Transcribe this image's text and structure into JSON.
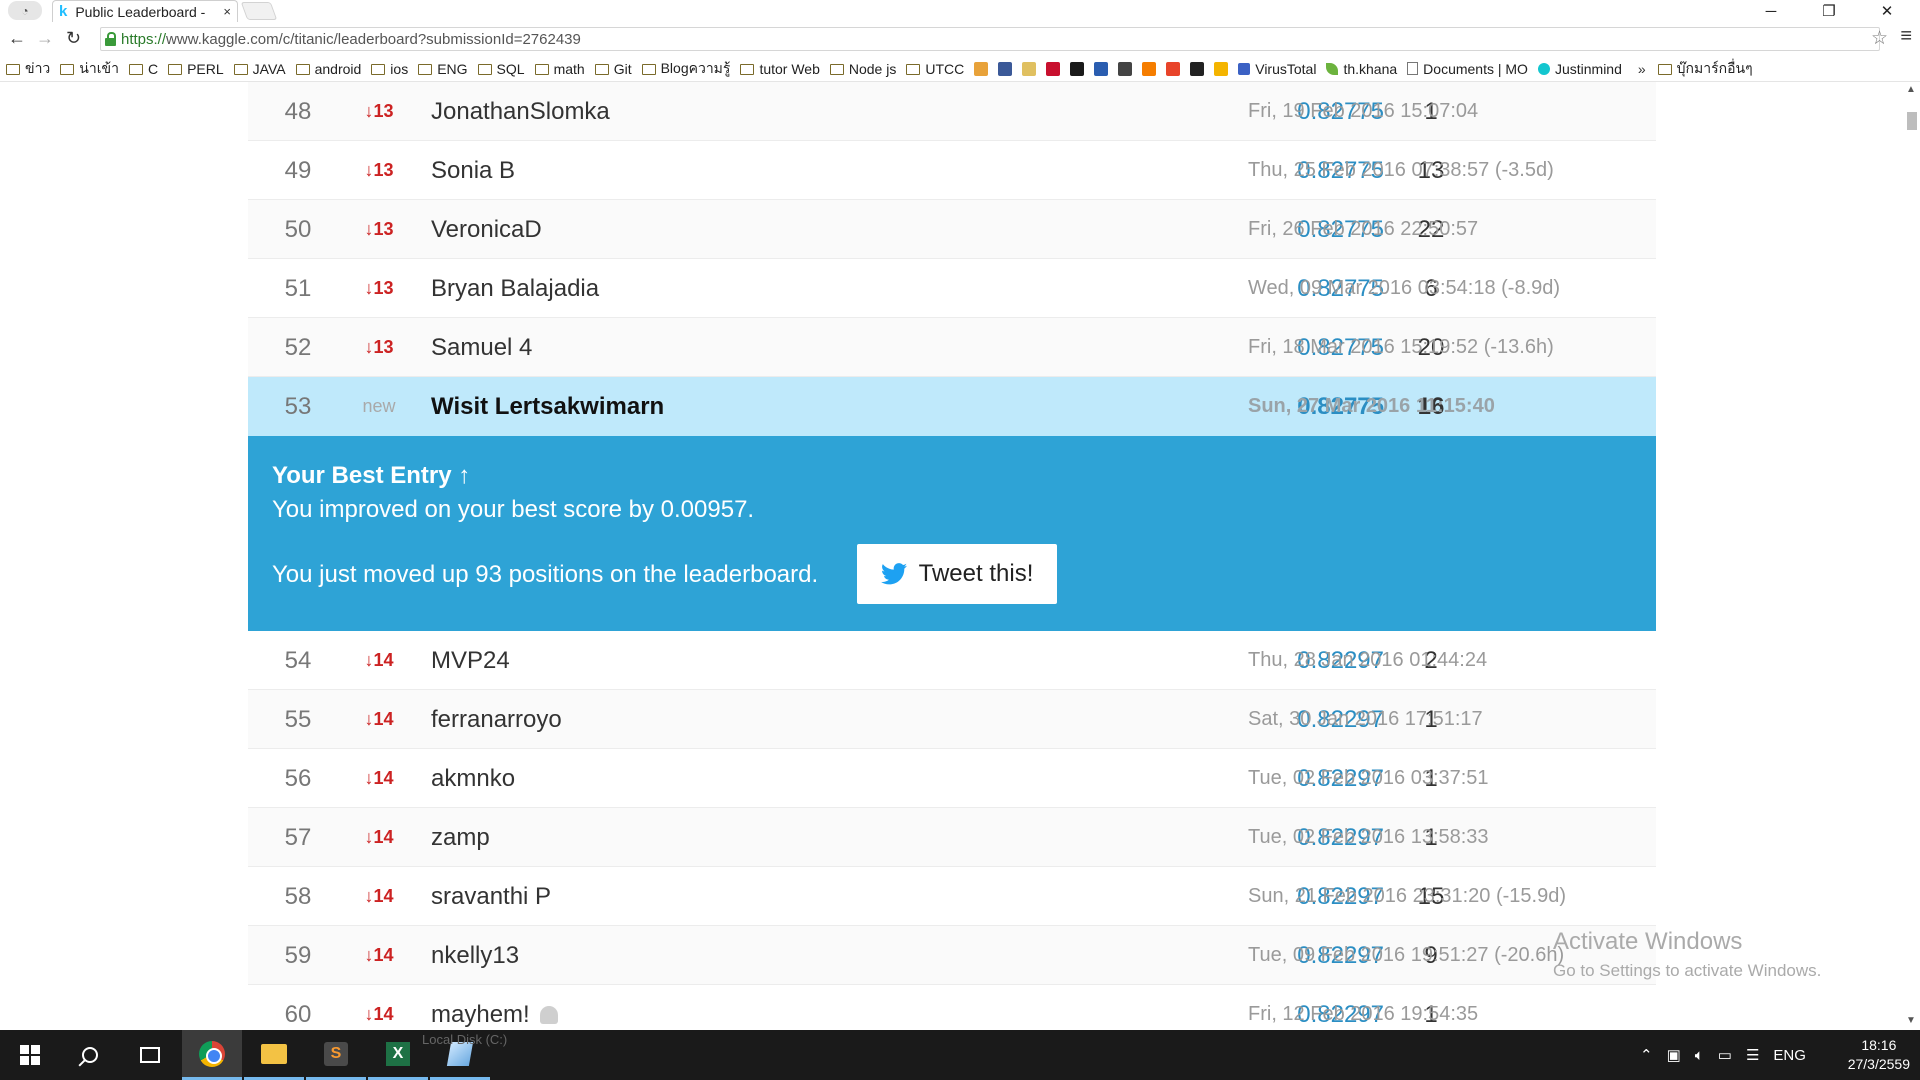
{
  "browser": {
    "tab_title": "Public Leaderboard -",
    "tab_close": "×",
    "url_https": "https://",
    "url_rest": "www.kaggle.com/c/titanic/leaderboard?submissionId=2762439",
    "window_minimize": "─",
    "window_restore": "❐",
    "window_close": "✕",
    "back": "←",
    "forward": "→",
    "reload": "↻",
    "star": "☆",
    "menu": "≡"
  },
  "bookmarks": [
    {
      "label": "ข่าว",
      "icon": "folder-icon"
    },
    {
      "label": "น่าเข้า",
      "icon": "folder-icon"
    },
    {
      "label": "C",
      "icon": "folder-icon"
    },
    {
      "label": "PERL",
      "icon": "folder-icon"
    },
    {
      "label": "JAVA",
      "icon": "folder-icon"
    },
    {
      "label": "android",
      "icon": "folder-icon"
    },
    {
      "label": "ios",
      "icon": "folder-icon"
    },
    {
      "label": "ENG",
      "icon": "folder-icon"
    },
    {
      "label": "SQL",
      "icon": "folder-icon"
    },
    {
      "label": "math",
      "icon": "folder-icon"
    },
    {
      "label": "Git",
      "icon": "folder-icon"
    },
    {
      "label": "Blogความรู้",
      "icon": "folder-icon"
    },
    {
      "label": "tutor Web",
      "icon": "folder-icon"
    },
    {
      "label": "Node js",
      "icon": "folder-icon"
    },
    {
      "label": "UTCC",
      "icon": "folder-icon"
    }
  ],
  "bookmark_icons": [
    {
      "name": "hand-icon",
      "color": "#e8a23a"
    },
    {
      "name": "facebook-icon",
      "color": "#3b5998"
    },
    {
      "name": "smiley-icon",
      "color": "#e0c060"
    },
    {
      "name": "thai-flag-icon",
      "color": "#c8102e"
    },
    {
      "name": "imdb-icon",
      "color": "#1a1a1a"
    },
    {
      "name": "newspaper-icon",
      "color": "#2a5db0"
    },
    {
      "name": "spider-icon",
      "color": "#444444"
    },
    {
      "name": "blogger-icon",
      "color": "#f57d00"
    },
    {
      "name": "t-icon",
      "color": "#e8442a"
    },
    {
      "name": "x-icon",
      "color": "#222222"
    },
    {
      "name": "sun-icon",
      "color": "#f4b400"
    }
  ],
  "bookmarks_tail": [
    {
      "label": "VirusTotal",
      "icon": "virustotal-icon"
    },
    {
      "label": "th.khana",
      "icon": "leaf-icon"
    },
    {
      "label": "Documents | MO",
      "icon": "document-icon"
    },
    {
      "label": "Justinmind",
      "icon": "justinmind-icon"
    }
  ],
  "bookmarks_overflow": "»",
  "bookmarks_other": "บุ๊กมาร์กอื่นๆ",
  "leaderboard_top": [
    {
      "rank": "48",
      "delta": "↓13",
      "team": "JonathanSlomka",
      "score": "0.82775",
      "entries": "1",
      "last": "Fri, 19 Feb 2016 15:07:04"
    },
    {
      "rank": "49",
      "delta": "↓13",
      "team": "Sonia B",
      "score": "0.82775",
      "entries": "13",
      "last": "Thu, 25 Feb 2016 07:38:57 (-3.5d)"
    },
    {
      "rank": "50",
      "delta": "↓13",
      "team": "VeronicaD",
      "score": "0.82775",
      "entries": "22",
      "last": "Fri, 26 Feb 2016 22:50:57"
    },
    {
      "rank": "51",
      "delta": "↓13",
      "team": "Bryan Balajadia",
      "score": "0.82775",
      "entries": "6",
      "last": "Wed, 09 Mar 2016 03:54:18 (-8.9d)"
    },
    {
      "rank": "52",
      "delta": "↓13",
      "team": "Samuel 4",
      "score": "0.82775",
      "entries": "20",
      "last": "Fri, 18 Mar 2016 15:19:52 (-13.6h)"
    }
  ],
  "my_row": {
    "rank": "53",
    "delta": "new",
    "team": "Wisit Lertsakwimarn",
    "score": "0.82775",
    "entries": "16",
    "last": "Sun, 27 Mar 2016 11:15:40"
  },
  "banner": {
    "title": "Your Best Entry ↑",
    "improved": "You improved on your best score by 0.00957.",
    "moved": "You just moved up 93 positions on the leaderboard.",
    "tweet": "Tweet this!"
  },
  "leaderboard_bottom": [
    {
      "rank": "54",
      "delta": "↓14",
      "team": "MVP24",
      "score": "0.82297",
      "entries": "2",
      "last": "Thu, 28 Jan 2016 01:44:24"
    },
    {
      "rank": "55",
      "delta": "↓14",
      "team": "ferranarroyo",
      "score": "0.82297",
      "entries": "1",
      "last": "Sat, 30 Jan 2016 17:51:17"
    },
    {
      "rank": "56",
      "delta": "↓14",
      "team": "akmnko",
      "score": "0.82297",
      "entries": "1",
      "last": "Tue, 02 Feb 2016 03:37:51"
    },
    {
      "rank": "57",
      "delta": "↓14",
      "team": "zamp",
      "score": "0.82297",
      "entries": "1",
      "last": "Tue, 02 Feb 2016 13:58:33"
    },
    {
      "rank": "58",
      "delta": "↓14",
      "team": "sravanthi P",
      "score": "0.82297",
      "entries": "15",
      "last": "Sun, 21 Feb 2016 23:31:20 (-15.9d)"
    },
    {
      "rank": "59",
      "delta": "↓14",
      "team": "nkelly13",
      "score": "0.82297",
      "entries": "9",
      "last": "Tue, 09 Feb 2016 19:51:27 (-20.6h)"
    },
    {
      "rank": "60",
      "delta": "↓14",
      "team": "mayhem!",
      "score": "0.82297",
      "entries": "1",
      "last": "Fri, 12 Feb 2016 19:54:35"
    }
  ],
  "watermark": {
    "line1": "Activate Windows",
    "line2": "Go to Settings to activate Windows."
  },
  "taskbar": {
    "ghost_text": "Local Disk (C:)",
    "language": "ENG",
    "time": "18:16",
    "date": "27/3/2559"
  },
  "colors": {
    "accent": "#2ea3d6",
    "highlight_row": "#bfe9fb",
    "score": "#2b8ec3",
    "delta_down": "#cc2222"
  }
}
